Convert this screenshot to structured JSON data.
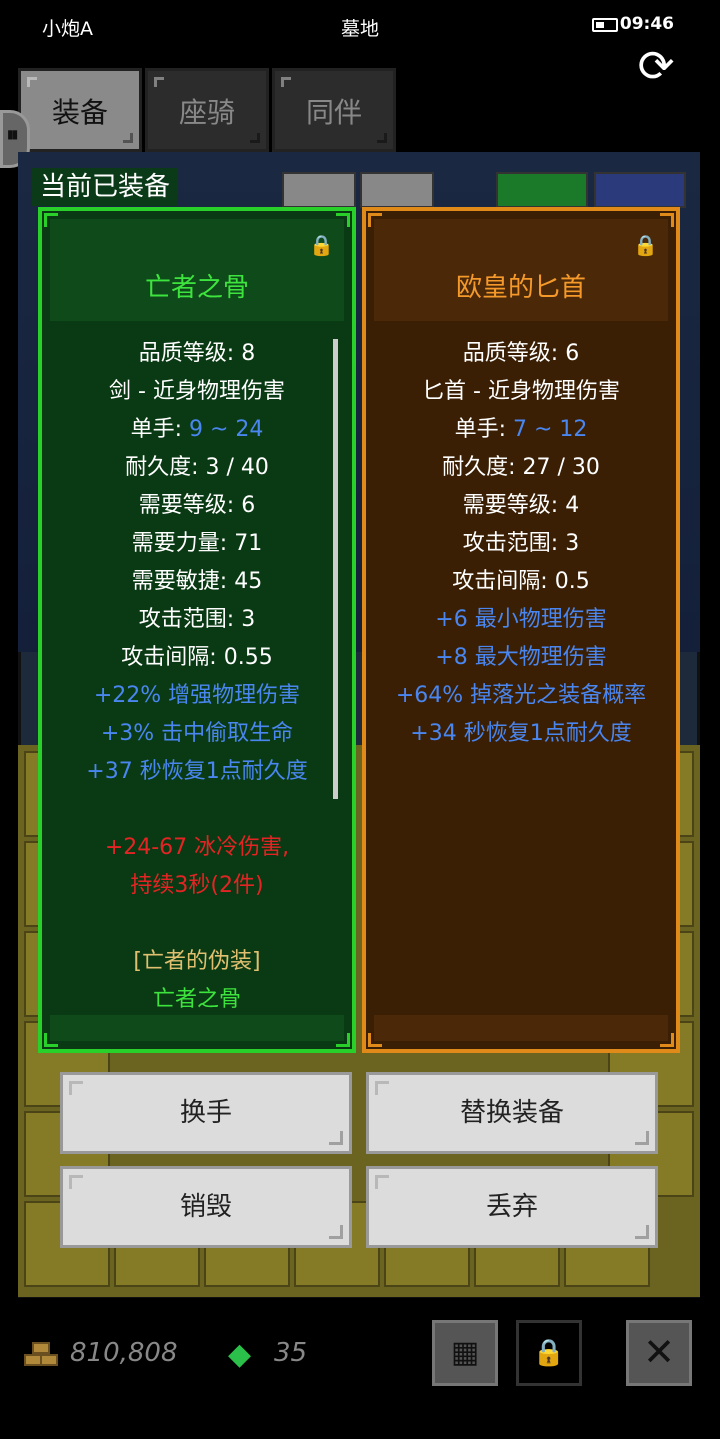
{
  "status_bar": {
    "player_name": "小炮A",
    "location": "墓地",
    "time": "09:46"
  },
  "tabs": [
    {
      "label": "装备",
      "active": true
    },
    {
      "label": "座骑",
      "active": false
    },
    {
      "label": "同伴",
      "active": false
    }
  ],
  "equipped_label": "当前已装备",
  "cards": [
    {
      "name": "亡者之骨",
      "theme": "green",
      "lines": [
        {
          "text": "品质等级: 8",
          "color": "white"
        },
        {
          "text": "剑 - 近身物理伤害",
          "color": "white"
        },
        {
          "label": "单手: ",
          "value": "9 ~ 24"
        },
        {
          "text": "耐久度: 3 / 40",
          "color": "white"
        },
        {
          "text": "需要等级: 6",
          "color": "white"
        },
        {
          "text": "需要力量: 71",
          "color": "white"
        },
        {
          "text": "需要敏捷: 45",
          "color": "white"
        },
        {
          "text": "攻击范围: 3",
          "color": "white"
        },
        {
          "text": "攻击间隔: 0.55",
          "color": "white"
        },
        {
          "text": "+22% 增强物理伤害",
          "color": "blue"
        },
        {
          "text": "+3% 击中偷取生命",
          "color": "blue"
        },
        {
          "text": "+37 秒恢复1点耐久度",
          "color": "blue"
        },
        {
          "text": "+24-67 冰冷伤害,",
          "color": "red"
        },
        {
          "text": "持续3秒(2件)",
          "color": "red"
        },
        {
          "text": "[亡者的伪装]",
          "color": "gold"
        },
        {
          "text": "亡者之骨",
          "color": "green"
        }
      ]
    },
    {
      "name": "欧皇的匕首",
      "theme": "orange",
      "lines": [
        {
          "text": "品质等级: 6",
          "color": "white"
        },
        {
          "text": "匕首 - 近身物理伤害",
          "color": "white"
        },
        {
          "label": "单手: ",
          "value": "7 ~ 12"
        },
        {
          "text": "耐久度: 27 / 30",
          "color": "white"
        },
        {
          "text": "需要等级: 4",
          "color": "white"
        },
        {
          "text": "攻击范围: 3",
          "color": "white"
        },
        {
          "text": "攻击间隔: 0.5",
          "color": "white"
        },
        {
          "text": "+6 最小物理伤害",
          "color": "blue"
        },
        {
          "text": "+8 最大物理伤害",
          "color": "blue"
        },
        {
          "text": "+64% 掉落光之装备概率",
          "color": "blue"
        },
        {
          "text": "+34 秒恢复1点耐久度",
          "color": "blue"
        }
      ]
    }
  ],
  "actions": {
    "swap_hand": "换手",
    "replace_equipment": "替换装备",
    "destroy": "销毁",
    "discard": "丢弃"
  },
  "currency": {
    "gold": "810,808",
    "gems": "35"
  },
  "colors": {
    "green_border": "#2ad02a",
    "orange_border": "#e08a1a",
    "stat_blue": "#4a86f0",
    "set_red": "#e42424"
  }
}
